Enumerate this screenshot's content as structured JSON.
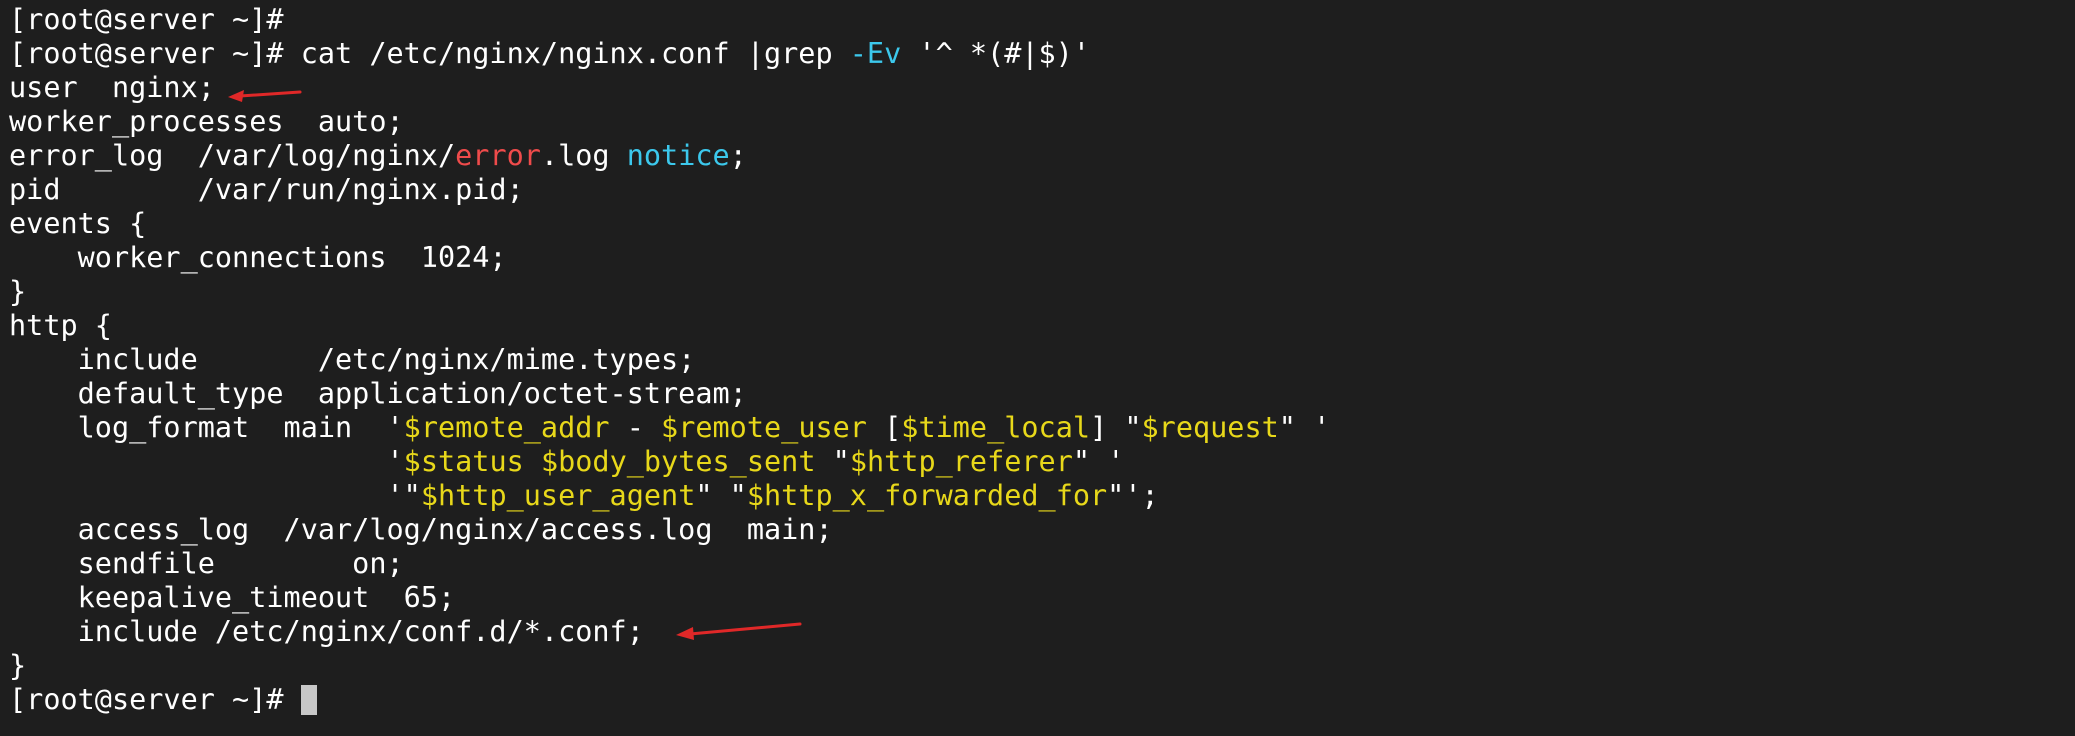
{
  "terminal": {
    "lines": [
      [
        {
          "t": "[root@server ~]#",
          "c": "plain"
        }
      ],
      [
        {
          "t": "[root@server ~]# cat /etc/nginx/nginx.conf |grep ",
          "c": "plain"
        },
        {
          "t": "-Ev",
          "c": "cyan"
        },
        {
          "t": " '^ *(#|$)'",
          "c": "plain"
        }
      ],
      [
        {
          "t": "user  nginx;",
          "c": "plain"
        }
      ],
      [
        {
          "t": "worker_processes  auto;",
          "c": "plain"
        }
      ],
      [
        {
          "t": "error_log  /var/log/nginx/",
          "c": "plain"
        },
        {
          "t": "error",
          "c": "red"
        },
        {
          "t": ".log ",
          "c": "plain"
        },
        {
          "t": "notice",
          "c": "cyan"
        },
        {
          "t": ";",
          "c": "plain"
        }
      ],
      [
        {
          "t": "pid        /var/run/nginx.pid;",
          "c": "plain"
        }
      ],
      [
        {
          "t": "events {",
          "c": "plain"
        }
      ],
      [
        {
          "t": "    worker_connections  1024;",
          "c": "plain"
        }
      ],
      [
        {
          "t": "}",
          "c": "plain"
        }
      ],
      [
        {
          "t": "http {",
          "c": "plain"
        }
      ],
      [
        {
          "t": "    include       /etc/nginx/mime.types;",
          "c": "plain"
        }
      ],
      [
        {
          "t": "    default_type  application/octet-stream;",
          "c": "plain"
        }
      ],
      [
        {
          "t": "    log_format  main  '",
          "c": "plain"
        },
        {
          "t": "$remote_addr",
          "c": "yellow"
        },
        {
          "t": " - ",
          "c": "plain"
        },
        {
          "t": "$remote_user",
          "c": "yellow"
        },
        {
          "t": " [",
          "c": "plain"
        },
        {
          "t": "$time_local",
          "c": "yellow"
        },
        {
          "t": "] \"",
          "c": "plain"
        },
        {
          "t": "$request",
          "c": "yellow"
        },
        {
          "t": "\" '",
          "c": "plain"
        }
      ],
      [
        {
          "t": "                      '",
          "c": "plain"
        },
        {
          "t": "$status",
          "c": "yellow"
        },
        {
          "t": " ",
          "c": "plain"
        },
        {
          "t": "$body_bytes_sent",
          "c": "yellow"
        },
        {
          "t": " \"",
          "c": "plain"
        },
        {
          "t": "$http_referer",
          "c": "yellow"
        },
        {
          "t": "\" '",
          "c": "plain"
        }
      ],
      [
        {
          "t": "                      '\"",
          "c": "plain"
        },
        {
          "t": "$http_user_agent",
          "c": "yellow"
        },
        {
          "t": "\" \"",
          "c": "plain"
        },
        {
          "t": "$http_x_forwarded_for",
          "c": "yellow"
        },
        {
          "t": "\"';",
          "c": "plain"
        }
      ],
      [
        {
          "t": "    access_log  /var/log/nginx/access.log  main;",
          "c": "plain"
        }
      ],
      [
        {
          "t": "    sendfile        on;",
          "c": "plain"
        }
      ],
      [
        {
          "t": "    keepalive_timeout  65;",
          "c": "plain"
        }
      ],
      [
        {
          "t": "    include /etc/nginx/conf.d/*.conf;",
          "c": "plain"
        }
      ],
      [
        {
          "t": "}",
          "c": "plain"
        }
      ],
      [
        {
          "t": "[root@server ~]# ",
          "c": "plain"
        }
      ]
    ],
    "cursor_line": 20
  },
  "annotations": {
    "arrow_color": "#e02828",
    "arrows": [
      {
        "points_to_line": 2,
        "description": "red-arrow"
      },
      {
        "points_to_line": 18,
        "description": "red-arrow"
      }
    ]
  },
  "colors": {
    "background": "#1e1e1e",
    "text": "#ffffff",
    "red": "#ef4b4b",
    "cyan": "#3cc8ec",
    "yellow": "#e8d81a",
    "cursor": "#c8c8c8"
  }
}
